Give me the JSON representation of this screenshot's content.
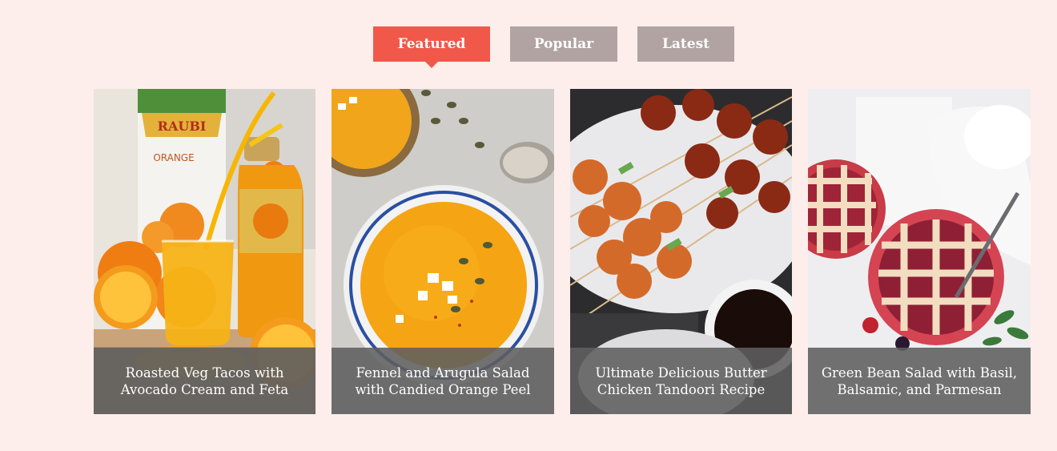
{
  "tabs": [
    {
      "label": "Featured",
      "active": true
    },
    {
      "label": "Popular",
      "active": false
    },
    {
      "label": "Latest",
      "active": false
    }
  ],
  "cards": [
    {
      "title": "Roasted Veg Tacos with Avocado Cream and Feta",
      "photo": "orange-juice-bottle-photo"
    },
    {
      "title": "Fennel and Arugula Salad with Candied Orange Peel",
      "photo": "pumpkin-soup-bowl-photo"
    },
    {
      "title": "Ultimate Delicious Butter Chicken Tandoori Recipe",
      "photo": "grilled-shrimp-skewers-photo"
    },
    {
      "title": "Green Bean Salad with Basil, Balsamic, and Parmesan",
      "photo": "berry-lattice-pie-photo"
    }
  ],
  "photo_labels": {
    "juice_brand": "RAUBI",
    "juice_flavor": "ORANGE"
  },
  "colors": {
    "background": "#fdeeec",
    "tab_active": "#f0584a",
    "tab_inactive": "#b0a3a1",
    "caption_overlay": "#5f5f5f"
  }
}
